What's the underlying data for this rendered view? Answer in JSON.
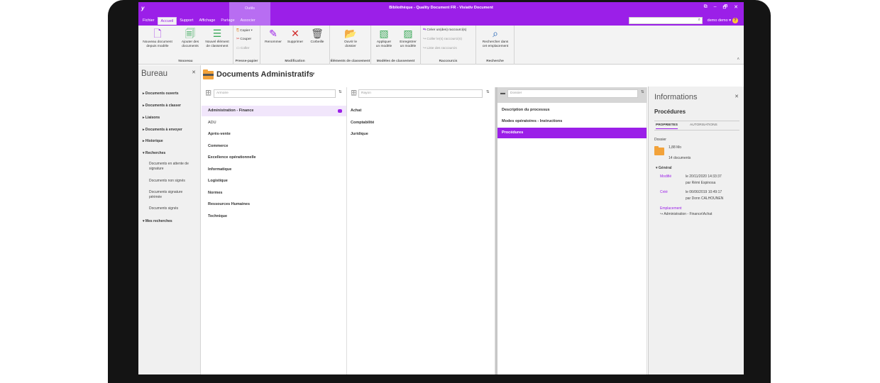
{
  "window": {
    "logo": "y",
    "title": "Bibliothèque - Quality Document FR - Visiativ Document",
    "context_group": "Outils",
    "buttons": {
      "restore": "⧉",
      "minimize": "–",
      "maximize": "🗗",
      "close": "✕"
    }
  },
  "tabs": [
    {
      "label": "Fichier",
      "active": false
    },
    {
      "label": "Accueil",
      "active": true
    },
    {
      "label": "Support",
      "active": false
    },
    {
      "label": "Affichage",
      "active": false
    },
    {
      "label": "Partage",
      "active": false,
      "contextual": true
    },
    {
      "label": "Associer",
      "active": false,
      "contextual": true
    }
  ],
  "search": {
    "placeholder": ""
  },
  "user": {
    "name": "demo demo ▾",
    "help": "?"
  },
  "ribbon": {
    "groups": {
      "nouveau": "Nouveau",
      "presse_papier": "Presse-papier",
      "modification": "Modification",
      "classement": "Éléments de classement",
      "modeles": "Modèles de classement",
      "raccourcis": "Raccourcis",
      "recherche": "Recherche"
    },
    "buttons": {
      "nouveau_doc": [
        "Nouveau document",
        "depuis modèle"
      ],
      "ajouter_docs": [
        "Ajouter des",
        "documents"
      ],
      "nouvel_element": [
        "Nouvel élément",
        "de classement"
      ],
      "copier": "Copier",
      "couper": "Couper",
      "coller": "Coller",
      "renommer": "Renommer",
      "supprimer": "Supprimer",
      "corbeille": "Corbeille",
      "ouvrir_dossier": [
        "Ouvrir le",
        "dossier"
      ],
      "appliquer_modele": [
        "Appliquer",
        "un modèle"
      ],
      "enregistrer_modele": [
        "Enregistrer",
        "un modèle"
      ],
      "creer_raccourcis": "Créer un(des) raccourci(s)",
      "coller_raccourcis": "Coller le(s) raccourci(s)",
      "liste_raccourcis": "Liste des raccourcis",
      "rechercher": [
        "Rechercher dans",
        "cet emplacement"
      ]
    }
  },
  "bureau": {
    "title": "Bureau",
    "items": [
      "Documents ouverts",
      "Documents à classer",
      "Liaisons",
      "Documents à envoyer",
      "Historique",
      "Recherches"
    ],
    "recherches": [
      "Documents en attente de signature",
      "Documents non signés",
      "Documents signature périmée",
      "Documents signés"
    ],
    "mes_recherches": "Mes recherches"
  },
  "main": {
    "title": "Documents Administratifs"
  },
  "columns": {
    "armoire": {
      "placeholder": "Armoire",
      "items": [
        "Administration - Finance",
        "ADU",
        "Après-vente",
        "Commerce",
        "Excellence opérationnelle",
        "Informatique",
        "Logistique",
        "Normes",
        "Ressources Humaines",
        "Technique"
      ]
    },
    "rayon": {
      "placeholder": "Rayon",
      "items": [
        "Achat",
        "Comptabilité",
        "Juridique"
      ]
    },
    "dossier": {
      "placeholder": "Dossier",
      "items": [
        "Description du processus",
        "Modes opératoires - Instructions",
        "Procédures"
      ]
    }
  },
  "info": {
    "title": "Informations",
    "subject": "Procédures",
    "tabs": [
      "PROPRIETES",
      "AUTORISATIONS"
    ],
    "type": "Dossier",
    "size": "1,88 Mo",
    "count": "14 documents",
    "section": "Général",
    "modified_label": "Modifié",
    "modified_date": "le 20/11/2020 14:33:37",
    "modified_by": "par Rémi Espinosa",
    "created_label": "Créé",
    "created_date": "le 06/06/2019 10:49:17",
    "created_by": "par Donn CALHOUNEN",
    "location_label": "Emplacement",
    "location": "Administration - Finance\\Achat"
  },
  "colors": {
    "accent": "#9b1fe8",
    "folder": "#f2a23a"
  }
}
